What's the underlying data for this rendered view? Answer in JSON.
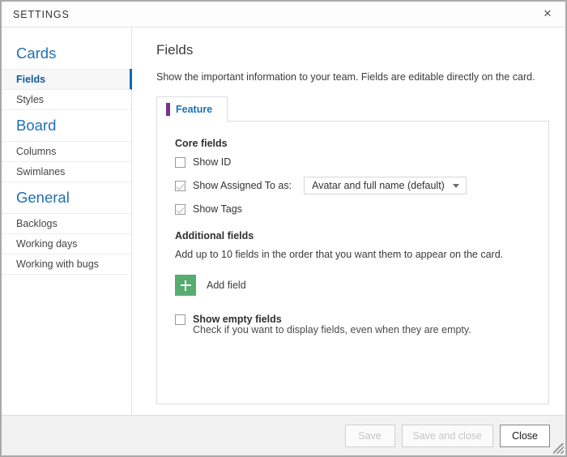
{
  "window": {
    "title": "SETTINGS",
    "close_icon": "close-icon",
    "close_glyph": "✕"
  },
  "sidebar": {
    "groups": [
      {
        "title": "Cards",
        "items": [
          {
            "label": "Fields",
            "selected": true
          },
          {
            "label": "Styles",
            "selected": false
          }
        ]
      },
      {
        "title": "Board",
        "items": [
          {
            "label": "Columns",
            "selected": false
          },
          {
            "label": "Swimlanes",
            "selected": false
          }
        ]
      },
      {
        "title": "General",
        "items": [
          {
            "label": "Backlogs",
            "selected": false
          },
          {
            "label": "Working days",
            "selected": false
          },
          {
            "label": "Working with bugs",
            "selected": false
          }
        ]
      }
    ]
  },
  "main": {
    "title": "Fields",
    "description": "Show the important information to your team. Fields are editable directly on the card.",
    "tabs": [
      {
        "label": "Feature",
        "active": true,
        "accent_color": "#78328c"
      }
    ],
    "core_fields": {
      "heading": "Core fields",
      "show_id": {
        "label": "Show ID",
        "checked": false
      },
      "show_assigned_to": {
        "label": "Show Assigned To as:",
        "checked": true,
        "selected_option": "Avatar and full name (default)"
      },
      "show_tags": {
        "label": "Show Tags",
        "checked": true
      }
    },
    "additional_fields": {
      "heading": "Additional fields",
      "description": "Add up to 10 fields in the order that you want them to appear on the card.",
      "add_field_label": "Add field",
      "add_icon": "plus-icon",
      "add_button_color": "#57ac6f"
    },
    "show_empty_fields": {
      "label": "Show empty fields",
      "description": "Check if you want to display fields, even when they are empty.",
      "checked": false
    }
  },
  "footer": {
    "buttons": [
      {
        "label": "Save",
        "enabled": false
      },
      {
        "label": "Save and close",
        "enabled": false
      },
      {
        "label": "Close",
        "enabled": true
      }
    ],
    "resize_grip": "resize-grip-icon"
  },
  "colors": {
    "accent_blue": "#0f69b4",
    "tab_accent_purple": "#78328c",
    "add_green": "#57ac6f"
  }
}
